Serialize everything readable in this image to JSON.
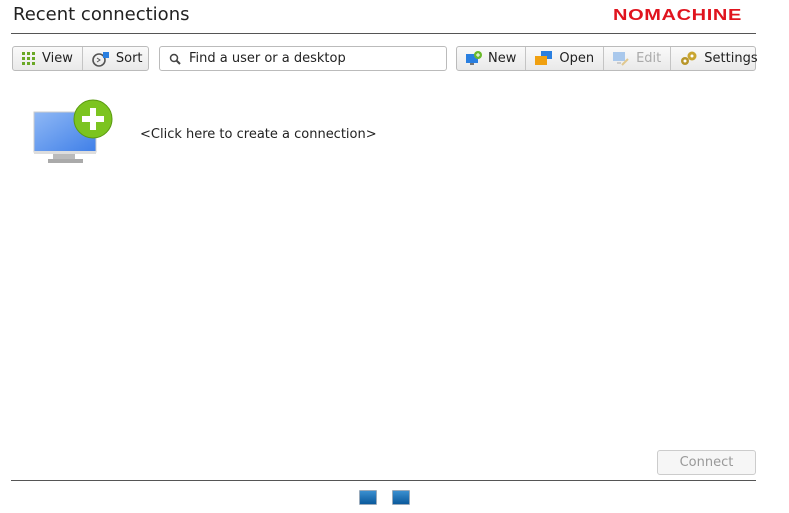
{
  "header": {
    "title": "Recent connections",
    "logo": "NOMACHINE",
    "brand_color": "#e0141e"
  },
  "toolbar": {
    "left": [
      {
        "label": "View",
        "icon": "grid-icon"
      },
      {
        "label": "Sort",
        "icon": "sort-icon"
      }
    ],
    "search": {
      "placeholder": "Find a user or a desktop",
      "value": ""
    },
    "right": [
      {
        "label": "New",
        "icon": "new-monitor-icon"
      },
      {
        "label": "Open",
        "icon": "folder-monitor-icon"
      },
      {
        "label": "Edit",
        "icon": "edit-monitor-icon",
        "disabled": true
      },
      {
        "label": "Settings",
        "icon": "gears-icon"
      }
    ]
  },
  "main": {
    "create_label": "<Click here to create a connection>"
  },
  "footer": {
    "connect_label": "Connect",
    "connect_disabled": true
  }
}
